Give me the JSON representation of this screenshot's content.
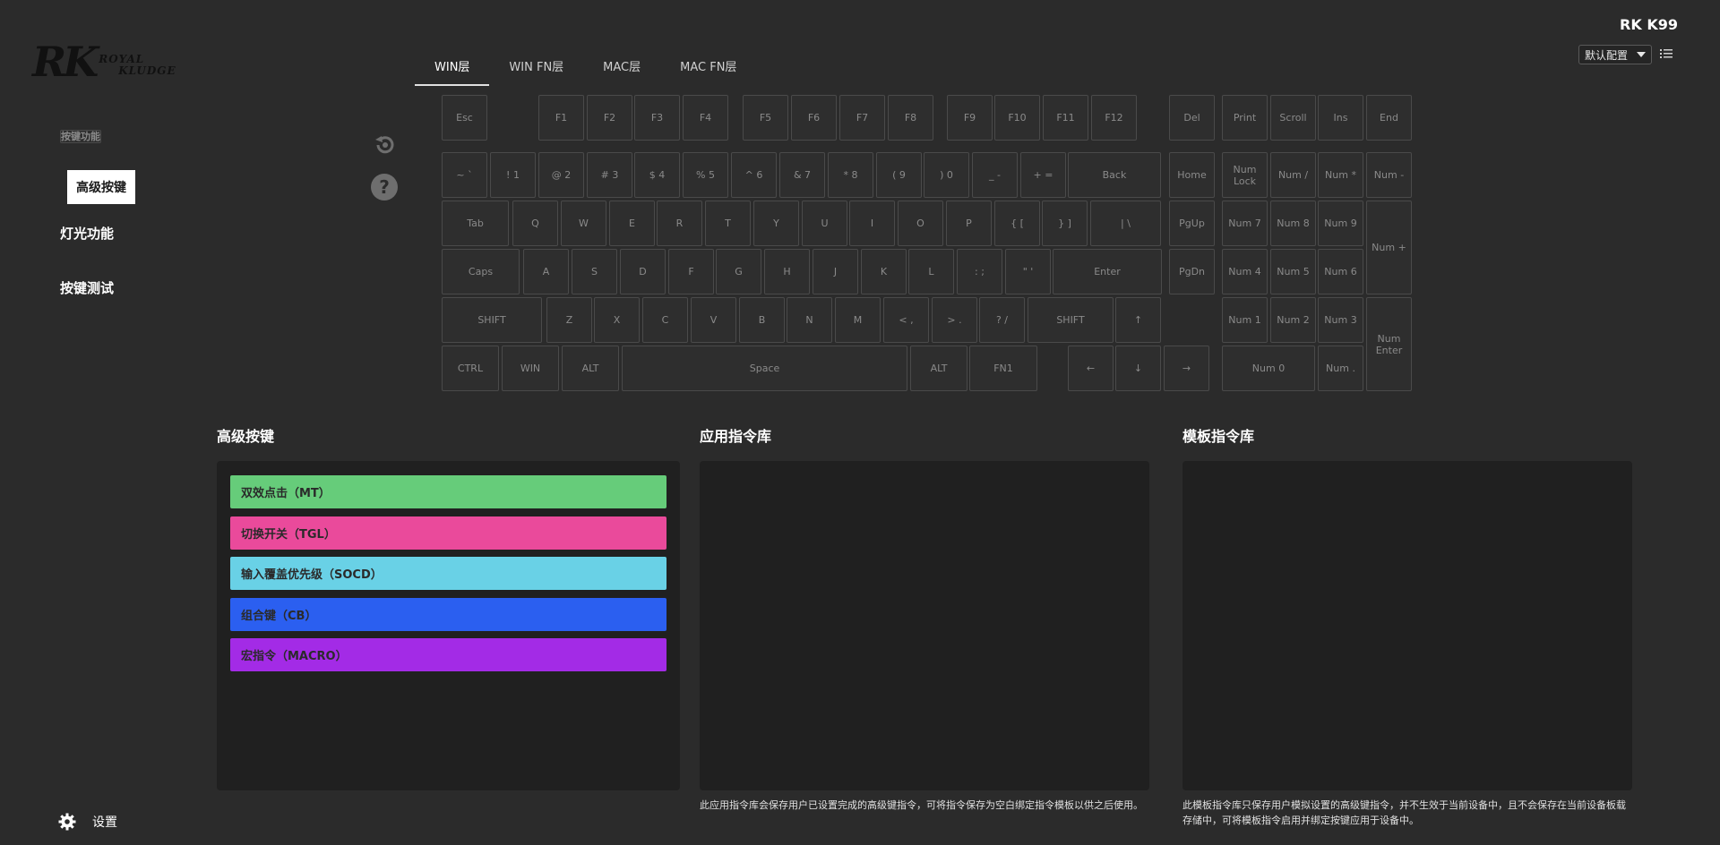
{
  "logo": {
    "mark": "RK",
    "line1": "ROYAL",
    "line2": "KLUDGE"
  },
  "device_name": "RK K99",
  "profile": {
    "selected": "默认配置"
  },
  "side_menu": {
    "key_function": "按键功能",
    "advanced_keys": "高级按键",
    "lighting": "灯光功能",
    "key_test": "按键测试"
  },
  "tabs": [
    "WIN层",
    "WIN FN层",
    "MAC层",
    "MAC FN层"
  ],
  "keys": [
    "Esc",
    "F1",
    "F2",
    "F3",
    "F4",
    "F5",
    "F6",
    "F7",
    "F8",
    "F9",
    "F10",
    "F11",
    "F12",
    "Del",
    "Print",
    "Scroll",
    "Ins",
    "End",
    "~ `",
    "! 1",
    "@ 2",
    "# 3",
    "$ 4",
    "% 5",
    "^ 6",
    "& 7",
    "* 8",
    "( 9",
    ") 0",
    "_ -",
    "+ =",
    "Back",
    "Home",
    "Num\nLock",
    "Num /",
    "Num *",
    "Num -",
    "Tab",
    "Q",
    "W",
    "E",
    "R",
    "T",
    "Y",
    "U",
    "I",
    "O",
    "P",
    "{ [",
    "} ]",
    "| \\",
    "PgUp",
    "Num 7",
    "Num 8",
    "Num 9",
    "Num +",
    "Caps",
    "A",
    "S",
    "D",
    "F",
    "G",
    "H",
    "J",
    "K",
    "L",
    ": ;",
    "\" '",
    "Enter",
    "PgDn",
    "Num 4",
    "Num 5",
    "Num 6",
    "SHIFT",
    "Z",
    "X",
    "C",
    "V",
    "B",
    "N",
    "M",
    "< ,",
    "> .",
    "? /",
    "SHIFT",
    "↑",
    "Num 1",
    "Num 2",
    "Num 3",
    "Num\nEnter",
    "CTRL",
    "WIN",
    "ALT",
    "Space",
    "ALT",
    "FN1",
    "←",
    "↓",
    "→",
    "Num 0",
    "Num ."
  ],
  "sections": {
    "advanced": {
      "title": "高级按键",
      "items": [
        {
          "label": "双效点击（MT）",
          "color": "#66cc7a"
        },
        {
          "label": "切换开关（TGL）",
          "color": "#ea4a9b"
        },
        {
          "label": "输入覆盖优先级（SOCD）",
          "color": "#69d1e6"
        },
        {
          "label": "组合键（CB）",
          "color": "#2b5ff0"
        },
        {
          "label": "宏指令（MACRO）",
          "color": "#a32be6"
        }
      ]
    },
    "app_library": {
      "title": "应用指令库",
      "desc": "此应用指令库会保存用户已设置完成的高级键指令，可将指令保存为空白绑定指令模板以供之后使用。"
    },
    "template_library": {
      "title": "模板指令库",
      "desc": "此模板指令库只保存用户模拟设置的高级键指令，并不生效于当前设备中，且不会保存在当前设备板载存储中，可将模板指令启用并绑定按键应用于设备中。"
    }
  },
  "settings_label": "设置"
}
